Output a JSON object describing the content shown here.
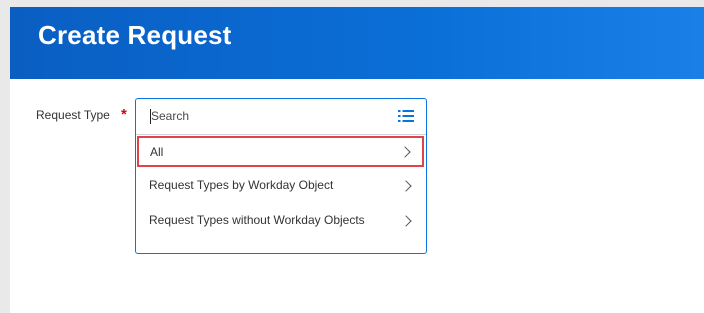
{
  "header": {
    "title": "Create Request"
  },
  "form": {
    "request_type_label": "Request Type",
    "required_marker": "*"
  },
  "prompt": {
    "search_placeholder": "Search",
    "list_icon": "list-icon",
    "options": [
      {
        "label": "All",
        "highlighted": true,
        "icon": "chevron-right-icon"
      },
      {
        "label": "Request Types by Workday Object",
        "icon": "chevron-right-icon"
      },
      {
        "label": "Request Types without Workday Objects",
        "icon": "chevron-right-icon"
      }
    ]
  },
  "colors": {
    "header": "#0b6fd8",
    "focus_border": "#0875e1",
    "highlight_border": "#e0434a",
    "required": "#d0021b"
  }
}
